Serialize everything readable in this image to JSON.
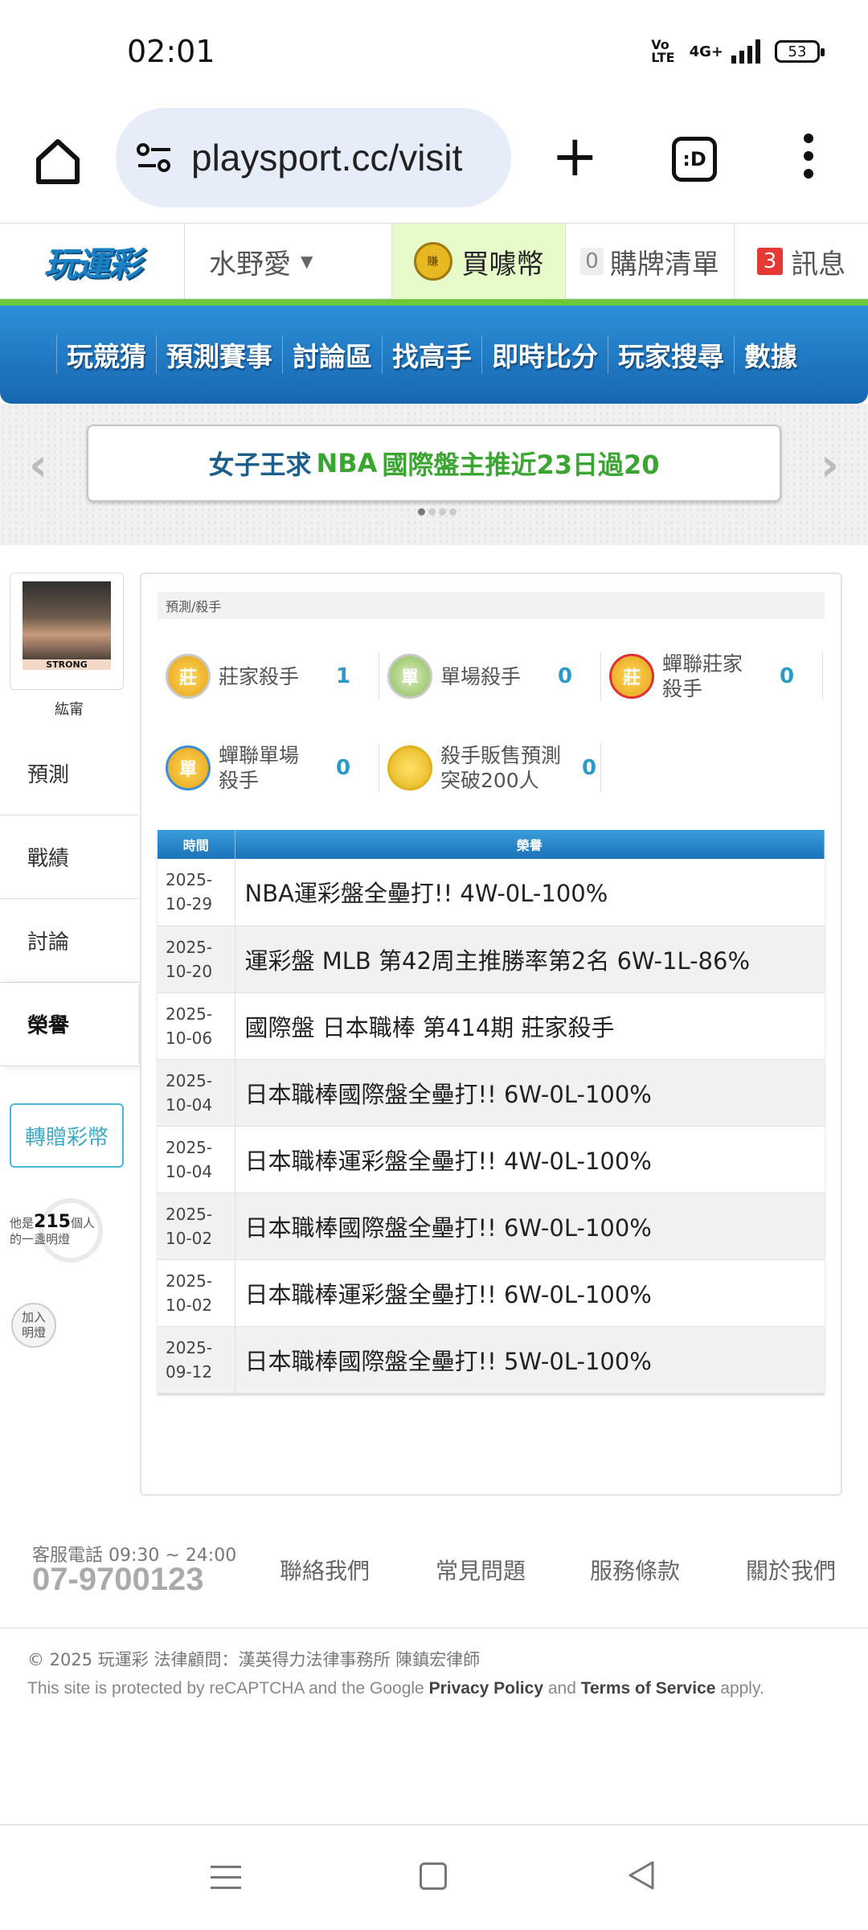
{
  "status": {
    "time": "02:01",
    "volte": "Vo\nLTE",
    "network": "4G+",
    "battery": "53"
  },
  "browser": {
    "url": "playsport.cc/visit",
    "tabs_label": ":D"
  },
  "site_header": {
    "logo": "玩運彩",
    "user": "水野愛",
    "buy_coin_icon": "賺",
    "buy_coin": "買噱幣",
    "buy_list_count": "0",
    "buy_list": "購牌清單",
    "message_count": "3",
    "message": "訊息"
  },
  "nav": [
    "玩競猜",
    "預測賽事",
    "討論區",
    "找高手",
    "即時比分",
    "玩家搜尋",
    "數據"
  ],
  "banner": {
    "part1": "女子王求",
    "part2": "NBA",
    "part3": "國際盤主推近23日過20"
  },
  "sidebar": {
    "avatar_caption": "STRONG",
    "username": "紘甯",
    "menu": [
      "預測",
      "戰績",
      "討論",
      "榮譽"
    ],
    "gift": "轉贈彩幣",
    "lamp_prefix": "他是",
    "lamp_count": "215",
    "lamp_suffix1": "個人",
    "lamp_suffix2": "的一盞明燈",
    "join_lamp_1": "加入",
    "join_lamp_2": "明燈"
  },
  "main": {
    "breadcrumb": "預測/殺手",
    "kills": [
      {
        "icon": "莊",
        "label": "莊家殺手",
        "count": "1"
      },
      {
        "icon": "單",
        "label": "單場殺手",
        "count": "0"
      },
      {
        "icon": "莊",
        "label": "蟬聯莊家\n殺手",
        "count": "0"
      },
      {
        "icon": "單",
        "label": "蟬聯單場\n殺手",
        "count": "0"
      },
      {
        "icon": "",
        "label": "殺手販售預測\n突破200人",
        "count": "0"
      }
    ],
    "table_headers": {
      "date": "時間",
      "honor": "榮譽"
    },
    "honors": [
      {
        "date_y": "2025-",
        "date_md": "10-29",
        "text": "NBA運彩盤全壘打!! 4W-0L-100%"
      },
      {
        "date_y": "2025-",
        "date_md": "10-20",
        "text": "運彩盤 MLB 第42周主推勝率第2名 6W-1L-86%"
      },
      {
        "date_y": "2025-",
        "date_md": "10-06",
        "text": "國際盤 日本職棒 第414期 莊家殺手"
      },
      {
        "date_y": "2025-",
        "date_md": "10-04",
        "text": "日本職棒國際盤全壘打!! 6W-0L-100%"
      },
      {
        "date_y": "2025-",
        "date_md": "10-04",
        "text": "日本職棒運彩盤全壘打!! 4W-0L-100%"
      },
      {
        "date_y": "2025-",
        "date_md": "10-02",
        "text": "日本職棒國際盤全壘打!! 6W-0L-100%"
      },
      {
        "date_y": "2025-",
        "date_md": "10-02",
        "text": "日本職棒運彩盤全壘打!! 6W-0L-100%"
      },
      {
        "date_y": "2025-",
        "date_md": "09-12",
        "text": "日本職棒國際盤全壘打!! 5W-0L-100%"
      }
    ]
  },
  "footer": {
    "hotline_label": "客服電話 09:30 ~ 24:00",
    "hotline": "07-9700123",
    "links": [
      "聯絡我們",
      "常見問題",
      "服務條款",
      "關於我們"
    ],
    "copyright": "© 2025 玩運彩 法律顧問：漢英得力法律事務所 陳鎮宏律師",
    "recaptcha_1": "This site is protected by reCAPTCHA and the Google ",
    "privacy": "Privacy Policy",
    "and": " and ",
    "terms": "Terms of Service",
    "apply": " apply."
  }
}
